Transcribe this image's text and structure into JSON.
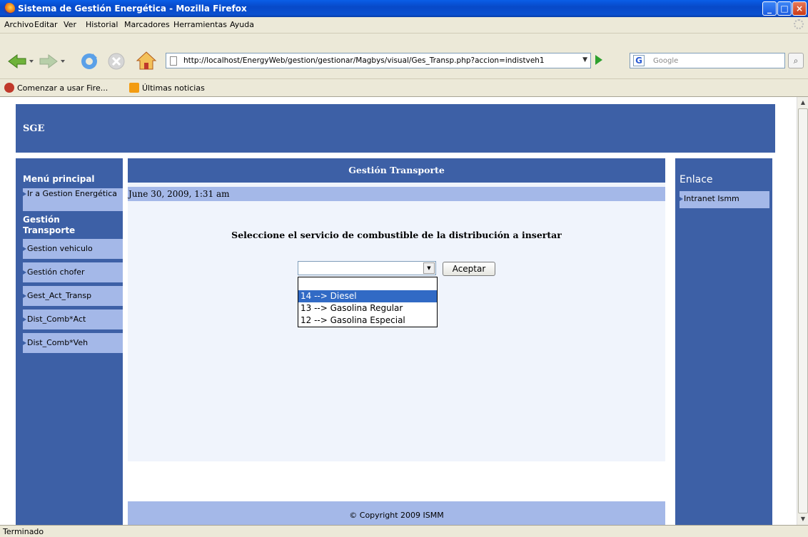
{
  "window": {
    "title": "Sistema de Gestión Energética - Mozilla Firefox",
    "min": "_",
    "max": "□",
    "close": "×"
  },
  "menubar": [
    "Archivo",
    "Editar",
    "Ver",
    "Historial",
    "Marcadores",
    "Herramientas",
    "Ayuda"
  ],
  "navbar": {
    "url": "http://localhost/EnergyWeb/gestion/gestionar/Magbys/visual/Ges_Transp.php?accion=indistveh1",
    "search_placeholder": "Google",
    "search_engine_letter": "G"
  },
  "bookmarks": [
    "Comenzar a usar Fire...",
    "Últimas noticias"
  ],
  "page": {
    "header": "SGE",
    "left": {
      "menu_title": "Menú principal",
      "main_link": "Ir a Gestion Energética",
      "section_title": "Gestión Transporte",
      "links": [
        "Gestion vehiculo",
        "Gestión chofer",
        "Gest_Act_Transp",
        "Dist_Comb*Act",
        "Dist_Comb*Veh"
      ]
    },
    "main": {
      "title": "Gestión Transporte",
      "date": "June 30, 2009, 1:31 am",
      "prompt": "Seleccione el servicio de combustible de la distribución a insertar",
      "select_value": "",
      "accept": "Aceptar",
      "options": [
        "14 --> Diesel",
        "13 --> Gasolina Regular",
        "12 --> Gasolina Especial"
      ],
      "selected_option": "14 --> Diesel",
      "footer": "© Copyright 2009 ISMM"
    },
    "right": {
      "title": "Enlace",
      "link": "Intranet Ismm"
    }
  },
  "status": "Terminado",
  "colors": {
    "accent": "#3d60a6",
    "light": "#a4b8e8",
    "selection": "#316ac5"
  }
}
